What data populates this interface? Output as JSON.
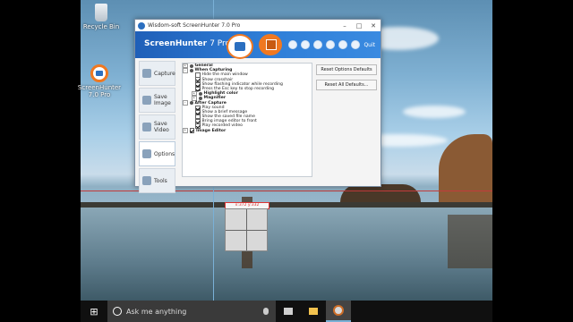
{
  "desktop": {
    "icons": [
      {
        "name": "Recycle Bin"
      },
      {
        "name": "ScreenHunter 7.0 Pro"
      }
    ]
  },
  "window": {
    "title": "Wisdom-soft ScreenHunter 7.0 Pro",
    "brand": "ScreenHunter",
    "brand_version": "7 Pro",
    "toolbar_quit": "Quit",
    "sidebar": [
      {
        "label": "Capture",
        "icon": "capture-icon"
      },
      {
        "label": "Save Image",
        "icon": "image-icon"
      },
      {
        "label": "Save Video",
        "icon": "video-icon"
      },
      {
        "label": "Options",
        "icon": "gear-icon"
      },
      {
        "label": "Tools",
        "icon": "tools-icon"
      }
    ],
    "tree": [
      {
        "label": "General",
        "type": "group"
      },
      {
        "label": "When Capturing",
        "type": "group"
      },
      {
        "label": "Hide the main window",
        "checked": false
      },
      {
        "label": "Show crosshair",
        "checked": true
      },
      {
        "label": "Show flashing indicator while recording",
        "checked": true
      },
      {
        "label": "Press the Esc key to stop recording",
        "checked": true
      },
      {
        "label": "Highlight color",
        "type": "sub"
      },
      {
        "label": "Magnifier",
        "type": "sub"
      },
      {
        "label": "After Capture",
        "type": "group"
      },
      {
        "label": "Play sound",
        "checked": true
      },
      {
        "label": "Show a brief message",
        "checked": true
      },
      {
        "label": "Show the saved file name",
        "checked": false
      },
      {
        "label": "Bring image editor to front",
        "checked": true
      },
      {
        "label": "Play recorded video",
        "checked": true
      },
      {
        "label": "Image Editor",
        "type": "group"
      }
    ],
    "buttons": {
      "reset_defaults": "Reset Options Defaults",
      "reset_all": "Reset All Defaults..."
    }
  },
  "magnifier": {
    "coords": "x:372  y:332"
  },
  "taskbar": {
    "search_placeholder": "Ask me anything",
    "items": [
      "task-view",
      "file-explorer",
      "screenhunter"
    ]
  },
  "colors": {
    "accent_orange": "#f07820",
    "banner_blue": "#2f7fd8",
    "crosshair_red": "#c23b3b"
  }
}
